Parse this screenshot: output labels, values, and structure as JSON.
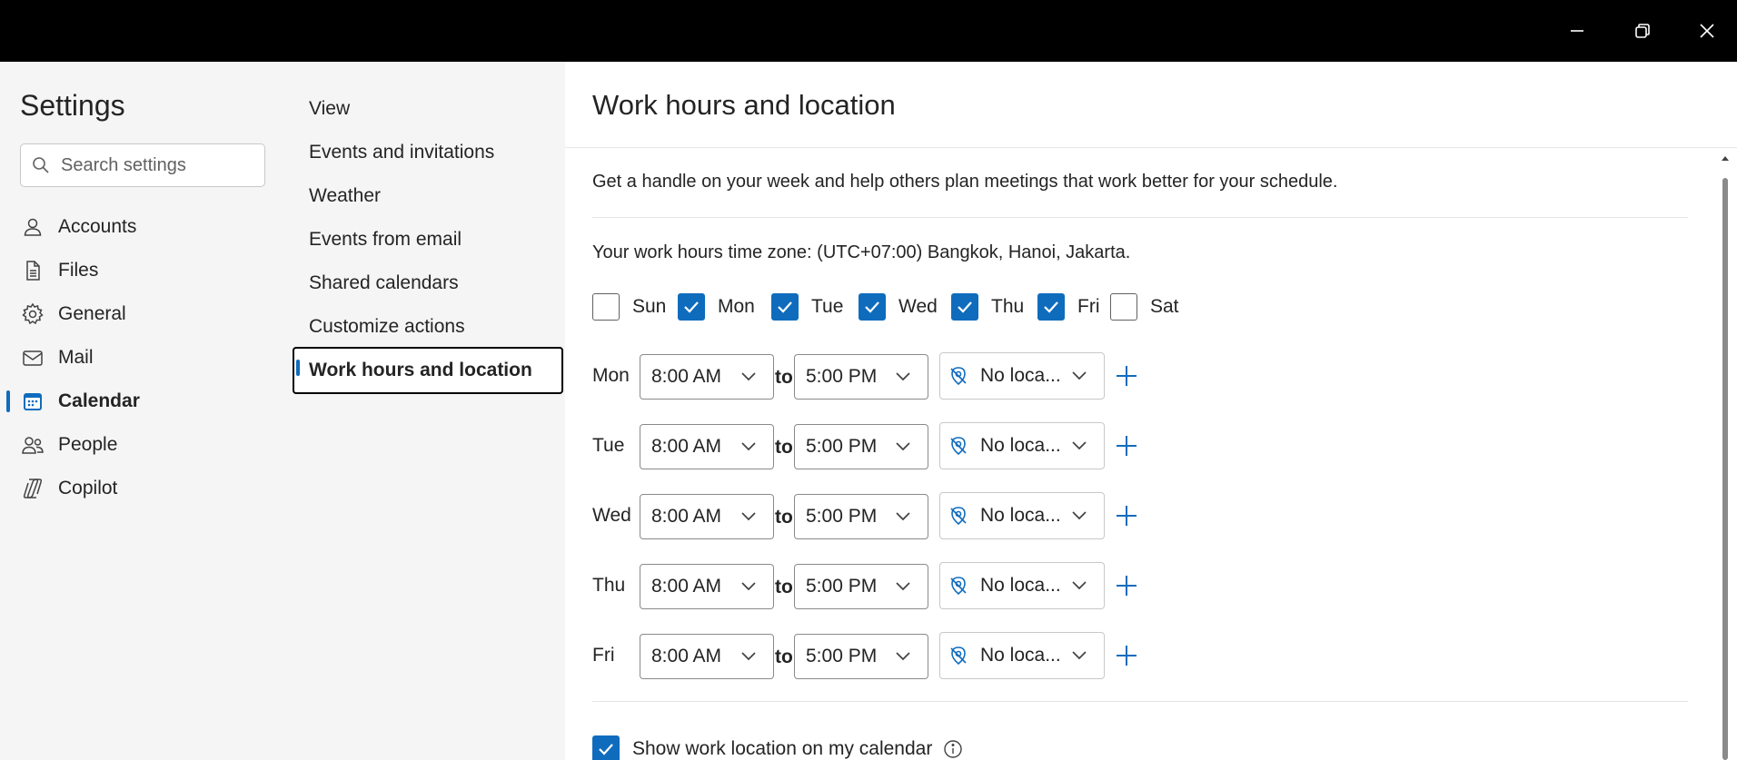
{
  "window": {
    "minimize_icon": "minimize-icon",
    "restore_icon": "restore-icon",
    "close_icon": "close-icon"
  },
  "sidebar": {
    "title": "Settings",
    "search_placeholder": "Search settings",
    "items": [
      {
        "label": "Accounts",
        "icon": "person-icon"
      },
      {
        "label": "Files",
        "icon": "document-icon"
      },
      {
        "label": "General",
        "icon": "gear-icon"
      },
      {
        "label": "Mail",
        "icon": "mail-icon"
      },
      {
        "label": "Calendar",
        "icon": "calendar-icon",
        "active": true
      },
      {
        "label": "People",
        "icon": "people-icon"
      },
      {
        "label": "Copilot",
        "icon": "copilot-icon"
      }
    ]
  },
  "subnav": {
    "items": [
      {
        "label": "View"
      },
      {
        "label": "Events and invitations"
      },
      {
        "label": "Weather"
      },
      {
        "label": "Events from email"
      },
      {
        "label": "Shared calendars"
      },
      {
        "label": "Customize actions"
      },
      {
        "label": "Work hours and location",
        "active": true
      }
    ]
  },
  "main": {
    "title": "Work hours and location",
    "description": "Get a handle on your week and help others plan meetings that work better for your schedule.",
    "timezone": "Your work hours time zone: (UTC+07:00) Bangkok, Hanoi, Jakarta.",
    "days": [
      {
        "label": "Sun",
        "checked": false
      },
      {
        "label": "Mon",
        "checked": true
      },
      {
        "label": "Tue",
        "checked": true
      },
      {
        "label": "Wed",
        "checked": true
      },
      {
        "label": "Thu",
        "checked": true
      },
      {
        "label": "Fri",
        "checked": true
      },
      {
        "label": "Sat",
        "checked": false
      }
    ],
    "to_label": "to",
    "rows": [
      {
        "day": "Mon",
        "start": "8:00 AM",
        "end": "5:00 PM",
        "location": "No loca..."
      },
      {
        "day": "Tue",
        "start": "8:00 AM",
        "end": "5:00 PM",
        "location": "No loca..."
      },
      {
        "day": "Wed",
        "start": "8:00 AM",
        "end": "5:00 PM",
        "location": "No loca..."
      },
      {
        "day": "Thu",
        "start": "8:00 AM",
        "end": "5:00 PM",
        "location": "No loca..."
      },
      {
        "day": "Fri",
        "start": "8:00 AM",
        "end": "5:00 PM",
        "location": "No loca..."
      }
    ],
    "show_location_label": "Show work location on my calendar",
    "show_location_checked": true
  },
  "colors": {
    "accent": "#0f6cbd",
    "titlebar": "#000000",
    "pane_bg": "#f5f5f5"
  }
}
